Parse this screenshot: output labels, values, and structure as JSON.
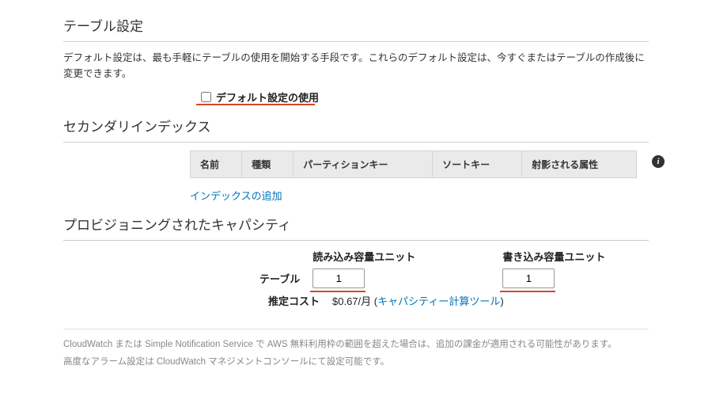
{
  "table_settings": {
    "title": "テーブル設定",
    "description": "デフォルト設定は、最も手軽にテーブルの使用を開始する手段です。これらのデフォルト設定は、今すぐまたはテーブルの作成後に変更できます。",
    "use_default_label": "デフォルト設定の使用",
    "use_default_checked": false
  },
  "secondary_index": {
    "title": "セカンダリインデックス",
    "columns": {
      "name": "名前",
      "type": "種類",
      "partition_key": "パーティションキー",
      "sort_key": "ソートキー",
      "projected_attrs": "射影される属性"
    },
    "add_index_label": "インデックスの追加"
  },
  "provisioned": {
    "title": "プロビジョニングされたキャパシティ",
    "read_header": "読み込み容量ユニット",
    "write_header": "書き込み容量ユニット",
    "row_table_label": "テーブル",
    "read_value": "1",
    "write_value": "1",
    "row_cost_label": "推定コスト",
    "cost_value": "$0.67/月",
    "capacity_calc_label": "キャパシティー計算ツール"
  },
  "footer": {
    "line1": "CloudWatch または Simple Notification Service で AWS 無料利用枠の範囲を超えた場合は、追加の課金が適用される可能性があります。",
    "line2": "高度なアラーム設定は CloudWatch マネジメントコンソールにて設定可能です。"
  }
}
